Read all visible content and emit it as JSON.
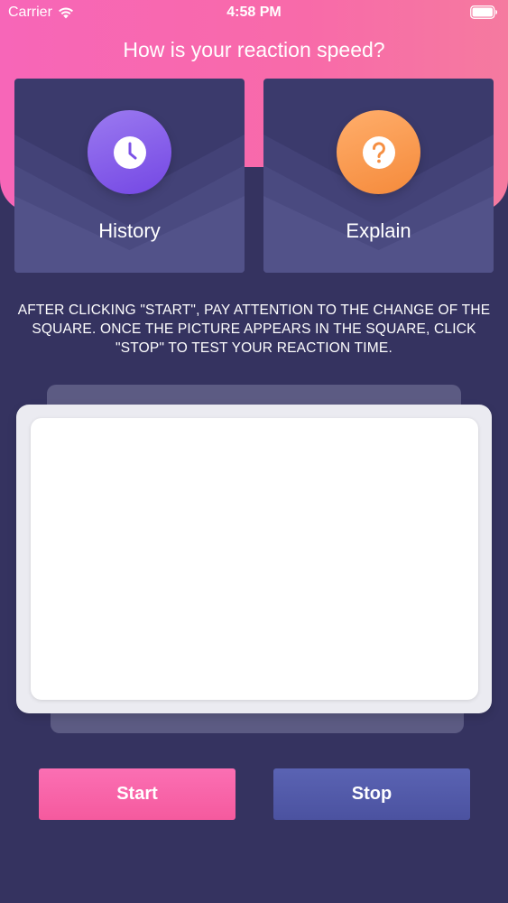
{
  "status_bar": {
    "carrier": "Carrier",
    "time": "4:58 PM"
  },
  "title": "How is your reaction speed?",
  "cards": {
    "history": {
      "label": "History",
      "icon": "clock-icon"
    },
    "explain": {
      "label": "Explain",
      "icon": "question-icon"
    }
  },
  "instructions": "AFTER CLICKING \"START\", PAY ATTENTION TO THE CHANGE OF THE SQUARE. ONCE THE PICTURE APPEARS IN THE SQUARE, CLICK \"STOP\" TO TEST YOUR REACTION TIME.",
  "buttons": {
    "start": "Start",
    "stop": "Stop"
  },
  "colors": {
    "header_pink": "#f766b8",
    "background": "#353360",
    "start_button": "#f55a9e",
    "stop_button": "#4b52a0"
  }
}
